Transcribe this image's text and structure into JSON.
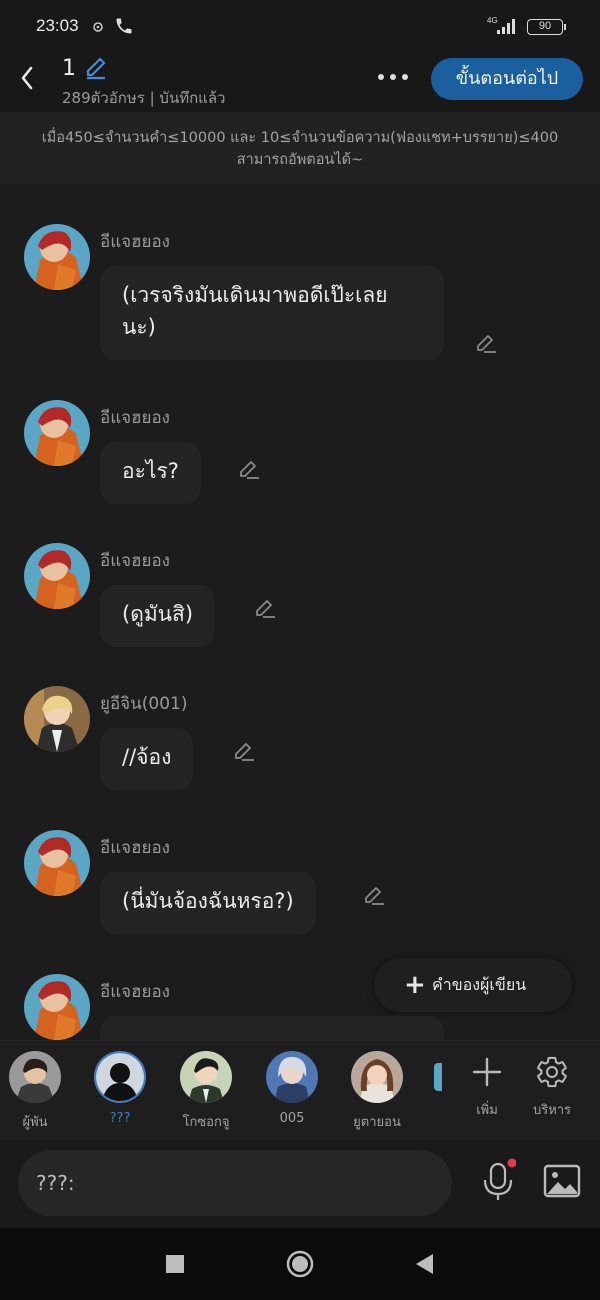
{
  "status_bar": {
    "time": "23:03",
    "network": "4G",
    "battery": "90"
  },
  "header": {
    "title": "1",
    "subtitle": "289ตัวอักษร | บันทึกแล้ว",
    "next_button": "ขั้นตอนต่อไป"
  },
  "notice": {
    "line1": "เมื่อ450≤จำนวนคำ≤10000 และ 10≤จำนวนข้อความ(ฟองแชท+บรรยาย)≤400",
    "line2": "สามารถอัพตอนได้~"
  },
  "messages": [
    {
      "sender": "อีแจฮยอง",
      "text_line1": "(เวรจริงมันเดินมาพอดีเป๊ะเลย",
      "text_line2": "นะ)"
    },
    {
      "sender": "อีแจฮยอง",
      "text": "อะไร?"
    },
    {
      "sender": "อีแจฮยอง",
      "text": "(ดูมันสิ)"
    },
    {
      "sender": "ยูอีจิน(001)",
      "text": "//จ้อง"
    },
    {
      "sender": "อีแจฮยอง",
      "text": "(นี่มันจ้องฉันหรอ?)"
    },
    {
      "sender": "อีแจฮยอง",
      "text": ""
    }
  ],
  "writer_button": "คำของผู้เขียน",
  "characters": [
    {
      "name": "ผู้พัน"
    },
    {
      "name": "???",
      "selected": true
    },
    {
      "name": "โกซอกจู"
    },
    {
      "name": "005"
    },
    {
      "name": "ยูตายอน"
    }
  ],
  "tools": {
    "add": "เพิ่ม",
    "manage": "บริหาร"
  },
  "input": {
    "value": "???:"
  },
  "colors": {
    "accent": "#1a5f9e",
    "background": "#1c1c1c",
    "bubble": "#242424",
    "mic_dot": "#e23a4a"
  }
}
